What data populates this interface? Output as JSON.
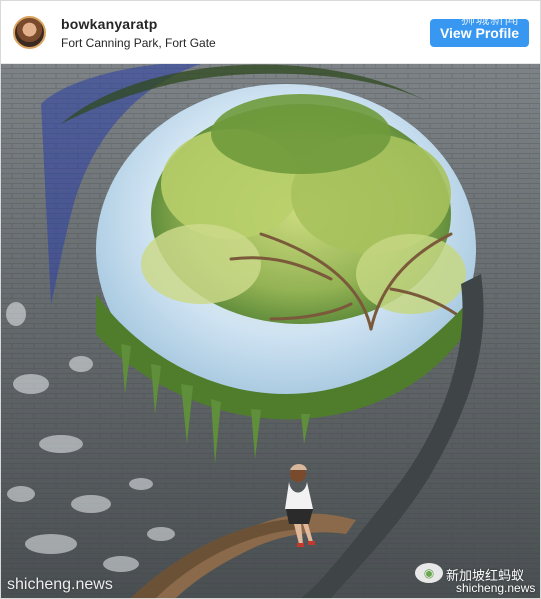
{
  "post": {
    "username": "bowkanyaratp",
    "location": "Fort Canning Park, Fort Gate",
    "view_profile_label": "View Profile"
  },
  "watermarks": {
    "top_right": "狮城新闻",
    "bottom_left": "shicheng.news",
    "bottom_right_cn": "新加坡红蚂蚁",
    "bottom_right_en": "shicheng.news"
  },
  "icons": {
    "avatar": "profile-avatar",
    "wechat": "wechat-icon"
  },
  "colors": {
    "button": "#3897f0",
    "text": "#262626",
    "wall": "#6f7476",
    "foliage": "#5f8f3a",
    "sky": "#cfe3f2"
  }
}
